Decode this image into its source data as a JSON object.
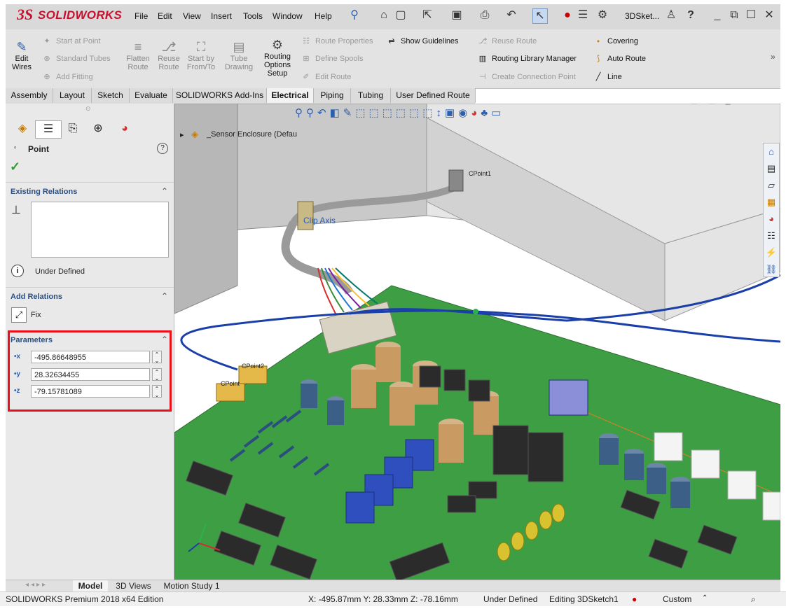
{
  "app": {
    "brand": "SOLIDWORKS",
    "brand_prefix": "3S",
    "doc_title": "3DSket..."
  },
  "menu": [
    "File",
    "Edit",
    "View",
    "Insert",
    "Tools",
    "Window",
    "Help"
  ],
  "command_manager": {
    "edit_wires": "Edit Wires",
    "start_at_point": "Start at Point",
    "standard_tubes": "Standard Tubes",
    "add_fitting": "Add Fitting",
    "flatten_route": "Flatten Route",
    "reuse_route_big": "Reuse Route",
    "start_by_from_to": "Start by From/To",
    "tube_drawing": "Tube Drawing",
    "routing_options_setup": "Routing Options Setup",
    "route_properties": "Route Properties",
    "define_spools": "Define Spools",
    "edit_route": "Edit Route",
    "show_guidelines": "Show Guidelines",
    "reuse_route": "Reuse Route",
    "routing_library_manager": "Routing Library Manager",
    "create_connection_point": "Create Connection Point",
    "covering": "Covering",
    "auto_route": "Auto Route",
    "line": "Line"
  },
  "tabs": [
    "Assembly",
    "Layout",
    "Sketch",
    "Evaluate",
    "SOLIDWORKS Add-Ins",
    "Electrical",
    "Piping",
    "Tubing",
    "User Defined Route"
  ],
  "active_tab": "Electrical",
  "property_manager": {
    "title": "Point",
    "existing_relations": "Existing Relations",
    "status": "Under Defined",
    "add_relations": "Add Relations",
    "fix": "Fix",
    "parameters": "Parameters",
    "x_value": "-495.86648955",
    "y_value": "28.32634455",
    "z_value": "-79.15781089"
  },
  "viewport": {
    "tree_root": "_Sensor Enclosure  (Defau",
    "labels": {
      "cpoint1": "CPoint1",
      "cpoint2": "CPoint2",
      "cpoint3": "CPoint",
      "clip_axis": "Clip Axis"
    }
  },
  "bottom_tabs": [
    "Model",
    "3D Views",
    "Motion Study 1"
  ],
  "active_bottom_tab": "Model",
  "status": {
    "edition": "SOLIDWORKS Premium 2018 x64 Edition",
    "coords": "X: -495.87mm Y: 28.33mm Z: -78.16mm",
    "state": "Under Defined",
    "editing": "Editing 3DSketch1",
    "units": "Custom"
  },
  "colors": {
    "brand_red": "#c8102e",
    "highlight_box": "#e8101a",
    "section_blue": "#2b4f81",
    "board_green": "#3e9e43",
    "wire_blue": "#1a3fa8"
  }
}
